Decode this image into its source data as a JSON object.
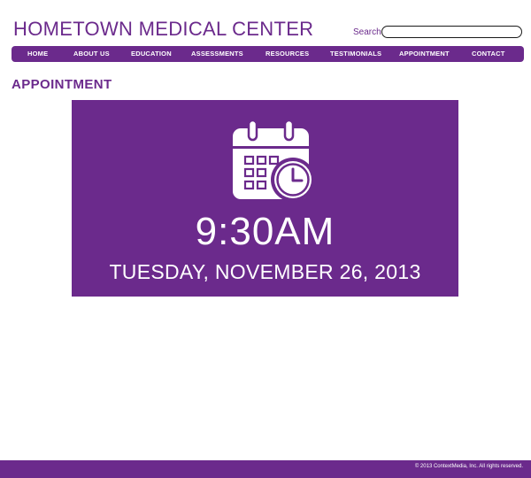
{
  "header": {
    "site_title": "HOMETOWN MEDICAL CENTER",
    "search_label": "Search:",
    "search_value": ""
  },
  "nav": {
    "items": [
      {
        "label": "HOME"
      },
      {
        "label": "ABOUT US"
      },
      {
        "label": "EDUCATION"
      },
      {
        "label": "ASSESSMENTS"
      },
      {
        "label": "RESOURCES"
      },
      {
        "label": "TESTIMONIALS"
      },
      {
        "label": "APPOINTMENT"
      },
      {
        "label": "CONTACT"
      }
    ]
  },
  "main": {
    "section_heading": "APPOINTMENT",
    "appointment": {
      "icon": "calendar-clock-icon",
      "time": "9:30AM",
      "date": "TUESDAY, NOVEMBER 26, 2013"
    }
  },
  "footer": {
    "copyright": "© 2013 ContextMedia, Inc. All rights reserved."
  },
  "colors": {
    "brand_purple": "#6b2a8c",
    "text_white": "#ffffff",
    "background": "#ffffff"
  }
}
